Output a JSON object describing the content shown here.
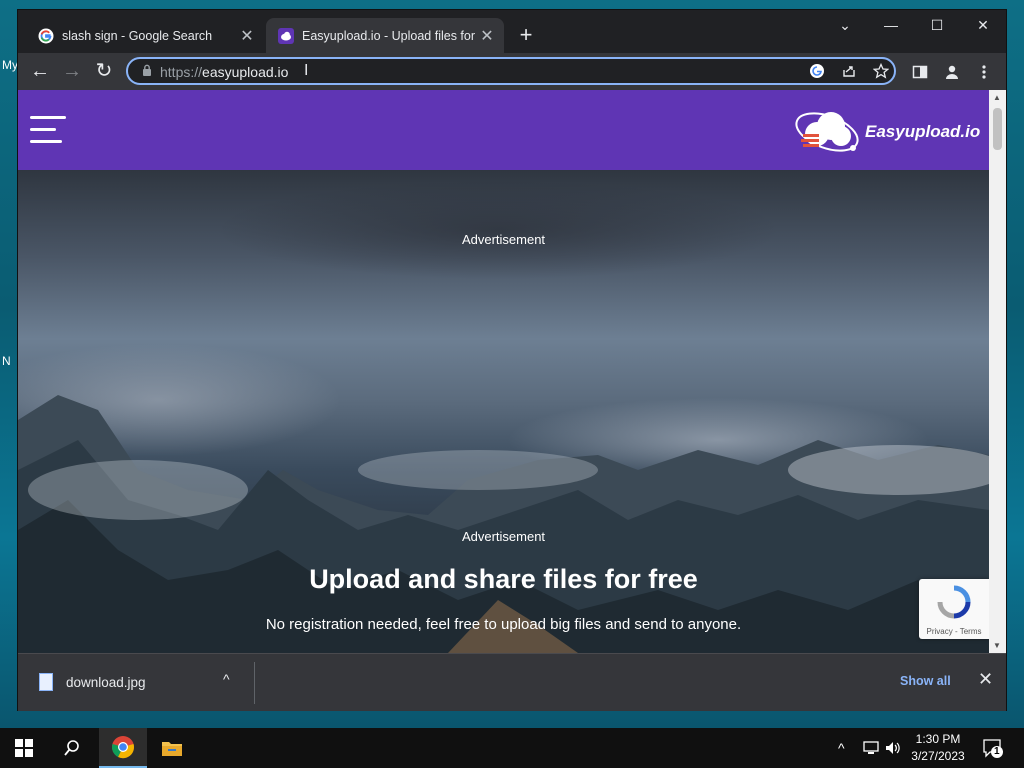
{
  "desktop": {
    "sliver_texts": [
      "My",
      "N"
    ]
  },
  "browser": {
    "tabs": [
      {
        "title": "slash sign - Google Search",
        "favicon": "google-g-icon",
        "active": false
      },
      {
        "title": "Easyupload.io - Upload files for fr",
        "favicon": "easyupload-favicon",
        "active": true
      }
    ],
    "close_glyph": "✕",
    "new_tab_glyph": "+",
    "window_controls": {
      "collapse": "⌄",
      "minimize": "—",
      "maximize": "☐",
      "close": "✕"
    },
    "nav": {
      "back": "←",
      "forward": "→",
      "reload": "↻"
    },
    "omnibox": {
      "scheme": "https://",
      "host": "easyupload.io",
      "cursor": "I"
    },
    "toolbar_icons": [
      "google-lens-icon",
      "share-icon",
      "bookmark-star-icon",
      "side-panel-icon",
      "profile-icon",
      "kebab-menu-icon"
    ]
  },
  "page": {
    "brand": "Easyupload.io",
    "ad_label_1": "Advertisement",
    "ad_label_2": "Advertisement",
    "headline": "Upload and share files for free",
    "subline": "No registration needed, feel free to upload big files and send to anyone.",
    "recaptcha": {
      "links": "Privacy - Terms"
    },
    "colors": {
      "header_bg": "#5f35b4",
      "logo_accent": "#e2533c"
    }
  },
  "downloads": {
    "file_name": "download.jpg",
    "show_all": "Show all",
    "chevron": "^",
    "close": "✕"
  },
  "taskbar": {
    "time": "1:30 PM",
    "date": "3/27/2023",
    "notification_count": "1",
    "tray_chevron": "^"
  }
}
